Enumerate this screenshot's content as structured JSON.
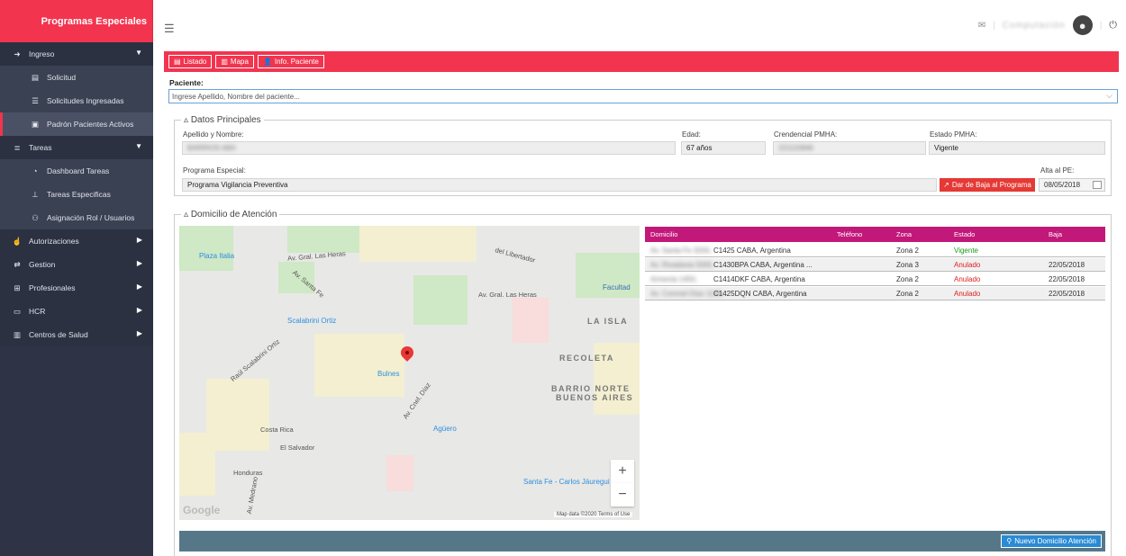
{
  "app": {
    "brand": "Programas Especiales"
  },
  "sidebar": {
    "items": [
      {
        "label": "Ingreso",
        "icon": "sign-in-icon",
        "level": "top",
        "caret": true
      },
      {
        "label": "Solicitud",
        "icon": "file-icon",
        "level": "sub"
      },
      {
        "label": "Solicitudes Ingresadas",
        "icon": "list-icon",
        "level": "sub"
      },
      {
        "label": "Padrón Pacientes Activos",
        "icon": "id-card-icon",
        "level": "sub",
        "active": true
      },
      {
        "label": "Tareas",
        "icon": "tasks-icon",
        "level": "top",
        "caret": true
      },
      {
        "label": "Dashboard Tareas",
        "icon": "pie-chart-icon",
        "level": "sub"
      },
      {
        "label": "Tareas Especificas",
        "icon": "pin-icon",
        "level": "sub"
      },
      {
        "label": "Asignación Rol / Usuarios",
        "icon": "users-add-icon",
        "level": "sub"
      },
      {
        "label": "Autorizaciones",
        "icon": "thumbs-up-icon",
        "level": "top",
        "caret": true
      },
      {
        "label": "Gestion",
        "icon": "exchange-icon",
        "level": "top",
        "caret": true
      },
      {
        "label": "Profesionales",
        "icon": "sitemap-icon",
        "level": "top",
        "caret": true
      },
      {
        "label": "HCR",
        "icon": "id-badge-icon",
        "level": "top",
        "caret": true
      },
      {
        "label": "Centros de Salud",
        "icon": "building-icon",
        "level": "top",
        "caret": true
      }
    ]
  },
  "topbar": {
    "user_name": "Computación"
  },
  "toolbar": {
    "listado": "Listado",
    "mapa": "Mapa",
    "info": "Info. Paciente"
  },
  "patient_search": {
    "label": "Paciente:",
    "placeholder": "Ingrese Apellido, Nombre del paciente..."
  },
  "datos": {
    "legend": "Datos Principales",
    "apellido_label": "Apellido y Nombre:",
    "apellido_value": "BARRIOS ABA",
    "edad_label": "Edad:",
    "edad_value": "67 años",
    "credencial_label": "Crendencial PMHA:",
    "credencial_value": "151110846",
    "estado_label": "Estado PMHA:",
    "estado_value": "Vigente",
    "programa_label": "Programa Especial:",
    "programa_value": "Programa Vigilancia Preventiva",
    "baja_button": "Dar de Baja al Programa",
    "alta_label": "Alta al PE:",
    "alta_value": "08/05/2018"
  },
  "domicilio": {
    "legend": "Domicilio de Atención",
    "columns": {
      "domicilio": "Domicilio",
      "telefono": "Teléfono",
      "zona": "Zona",
      "estado": "Estado",
      "baja": "Baja"
    },
    "rows": [
      {
        "dom_blur": "Av. Santa Fe 3200,",
        "dom": "C1425 CABA, Argentina",
        "tel": "",
        "zona": "Zona 2",
        "estado": "Vigente",
        "estado_color": "#1a9a1a",
        "baja": ""
      },
      {
        "dom_blur": "Av. Rivadavia 5000,",
        "dom": "C1430BPA CABA, Argentina ...",
        "tel": "",
        "zona": "Zona 3",
        "estado": "Anulado",
        "estado_color": "#e02020",
        "baja": "22/05/2018"
      },
      {
        "dom_blur": "Armenia 1450,",
        "dom": "C1414DKF CABA, Argentina",
        "tel": "",
        "zona": "Zona 2",
        "estado": "Anulado",
        "estado_color": "#e02020",
        "baja": "22/05/2018"
      },
      {
        "dom_blur": "Av. Coronel Díaz 1136,",
        "dom": "C1425DQN CABA, Argentina",
        "tel": "",
        "zona": "Zona 2",
        "estado": "Anulado",
        "estado_color": "#e02020",
        "baja": "22/05/2018"
      }
    ],
    "nuevo_button": "Nuevo Domicilio Atención"
  },
  "map": {
    "labels": {
      "plaza_italia": "Plaza Italia",
      "scalabrini": "Scalabrini Ortiz",
      "bulnes": "Bulnes",
      "aguero": "Agüero",
      "santa_fe_jaure": "Santa Fe - Carlos Jáuregui",
      "facultad": "Facultad",
      "la_isla": "LA ISLA",
      "recoleta": "RECOLETA",
      "barrio_norte_1": "BARRIO NORTE",
      "barrio_norte_2": "BUENOS AIRES",
      "las_heras_1": "Av. Gral. Las Heras",
      "las_heras_2": "Av. Gral. Las Heras",
      "las_heras_3": "Av. Gral. Las Heras",
      "libertador": "del Libertador",
      "santa_fe_av": "Av. Santa Fe",
      "raul_scal": "Raúl Scalabrini Ortiz",
      "honduras": "Honduras",
      "medrano": "Av. Medrano",
      "cnel_diaz": "Av. Cnel. Díaz",
      "costa_rica": "Costa Rica",
      "salvador": "El Salvador",
      "google": "Google",
      "map_data": "Map data ©2020",
      "terms": "Terms of Use"
    }
  }
}
